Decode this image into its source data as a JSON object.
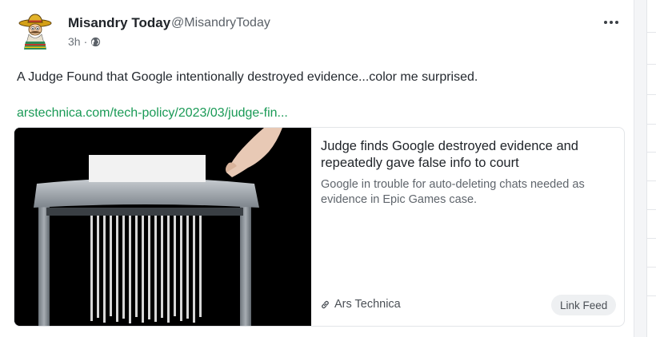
{
  "post": {
    "author_name": "Misandry Today",
    "author_handle": "@MisandryToday",
    "time": "3h",
    "separator": "·",
    "text": "A Judge Found that Google intentionally destroyed evidence...color me surprised.",
    "link_text": "arstechnica.com/tech-policy/2023/03/judge-fin..."
  },
  "card": {
    "title": "Judge finds Google destroyed evidence and repeatedly gave false info to court",
    "description": "Google in trouble for auto-deleting chats needed as evidence in Epic Games case.",
    "source": "Ars Technica",
    "badge": "Link Feed"
  },
  "icons": {
    "visibility": "globe-icon",
    "menu": "more-options-icon",
    "source": "link-icon"
  },
  "colors": {
    "link": "#1a9a56",
    "text": "#24292f",
    "muted": "#5b6168"
  }
}
